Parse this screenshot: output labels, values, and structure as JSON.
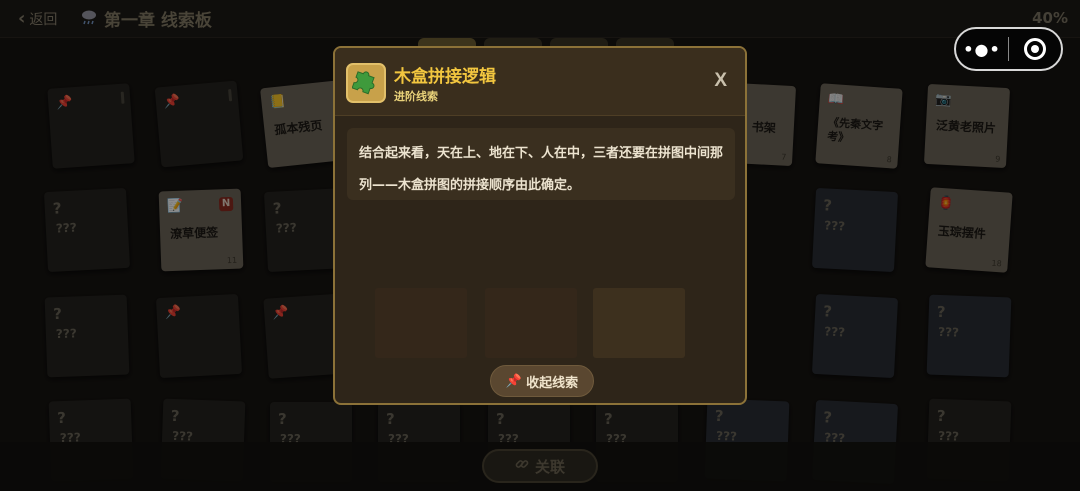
{
  "header": {
    "back_label": "返回",
    "chapter_title": "第一章 线索板",
    "progress": "40%",
    "weather_icon": "rain-cloud-icon"
  },
  "cards": [
    {
      "id": "c1",
      "title": "",
      "number": "",
      "icon": "pin-icon",
      "known": true
    },
    {
      "id": "c2",
      "title": "",
      "number": "",
      "icon": "pin-icon",
      "known": true
    },
    {
      "id": "c3",
      "title": "孤本残页",
      "number": "",
      "icon": "notepad-icon",
      "known": true
    },
    {
      "id": "c8",
      "title": "书架",
      "number": "7",
      "icon": "",
      "known": true
    },
    {
      "id": "c9",
      "title": "《先秦文字考》",
      "number": "8",
      "icon": "book-icon",
      "known": true
    },
    {
      "id": "c10",
      "title": "泛黄老照片",
      "number": "9",
      "icon": "camera-icon",
      "known": true
    },
    {
      "id": "c4",
      "title": "???",
      "number": "",
      "icon": "question-mark",
      "known": false
    },
    {
      "id": "c5",
      "title": "潦草便签",
      "number": "11",
      "icon": "memo-icon",
      "known": true,
      "badge": "N"
    },
    {
      "id": "c6",
      "title": "???",
      "number": "",
      "icon": "question-mark",
      "known": false
    },
    {
      "id": "c11",
      "title": "???",
      "number": "",
      "icon": "question-mark",
      "known": false
    },
    {
      "id": "c12",
      "title": "玉琮摆件",
      "number": "18",
      "icon": "jade-icon",
      "known": true
    },
    {
      "id": "c13",
      "title": "???",
      "number": "",
      "icon": "question-mark",
      "known": false
    },
    {
      "id": "c14",
      "title": "",
      "number": "",
      "icon": "pin-icon",
      "known": true
    },
    {
      "id": "c15",
      "title": "",
      "number": "",
      "icon": "pin-icon",
      "known": true
    },
    {
      "id": "c16",
      "title": "???",
      "number": "",
      "icon": "question-mark",
      "known": false
    },
    {
      "id": "c17",
      "title": "???",
      "number": "",
      "icon": "question-mark",
      "known": false
    },
    {
      "id": "c18",
      "title": "???",
      "number": "",
      "icon": "question-mark",
      "known": false
    }
  ],
  "bottom": {
    "link_label": "关联",
    "link_icon": "link-icon"
  },
  "modal": {
    "icon": "puzzle-piece-icon",
    "title": "木盒拼接逻辑",
    "subtitle": "进阶线索",
    "close_label": "X",
    "description": "结合起来看，天在上、地在下、人在中，三者还要在拼图中间那列——木盒拼图的拼接顺序由此确定。",
    "collapse_label": "收起线索",
    "collapse_icon": "pushpin-icon"
  },
  "system_capsule": {
    "menu_icon": "more-dots-icon",
    "close_icon": "target-circle-icon"
  },
  "colors": {
    "accent_gold": "#f2c63f",
    "modal_border": "#8c7238",
    "modal_bg": "#2e2519",
    "pin_red": "#d84238",
    "puzzle_green": "#3f9a3c"
  }
}
